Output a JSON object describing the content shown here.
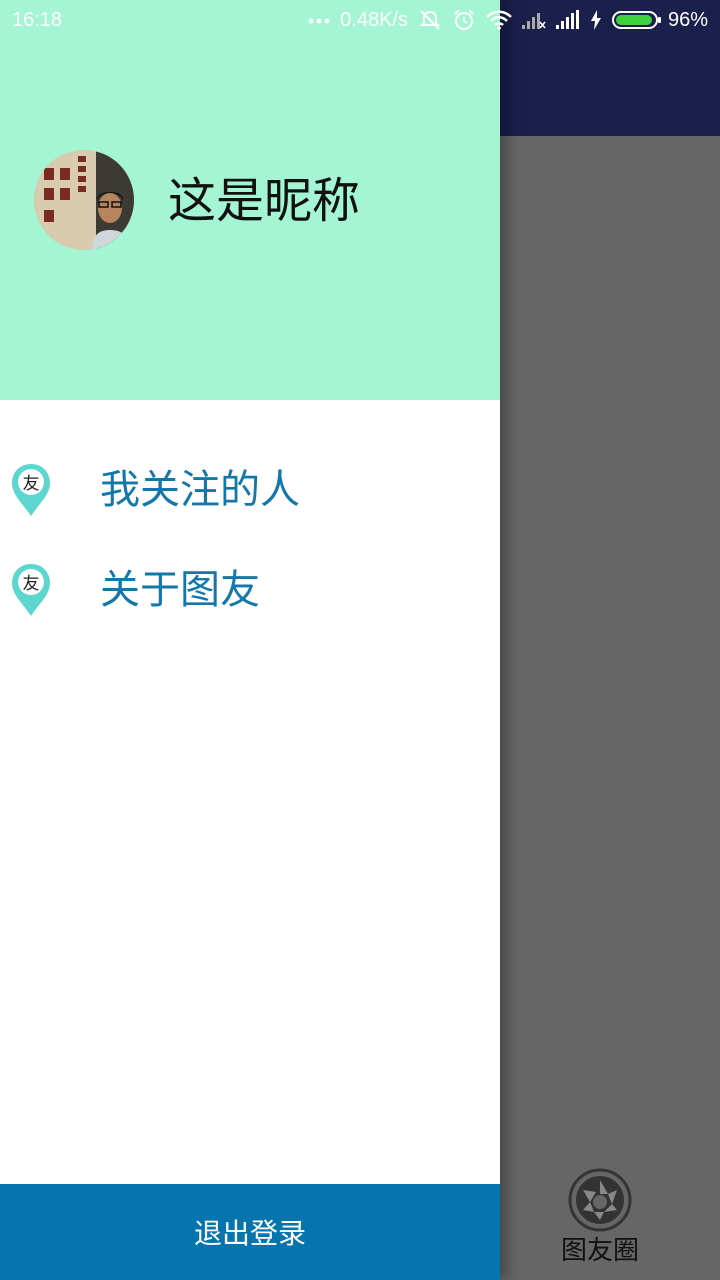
{
  "status_bar": {
    "time": "16:18",
    "net_speed": "0.48K/s",
    "battery": "96%",
    "battery_level": 0.96,
    "icons": [
      "more-dots-icon",
      "alarm-off-icon",
      "alarm-icon",
      "wifi-icon",
      "signal-x-icon",
      "signal-icon",
      "charging-icon",
      "battery-icon"
    ]
  },
  "drawer": {
    "nickname": "这是昵称",
    "menu": [
      {
        "label": "我关注的人",
        "icon": "you-pin-icon"
      },
      {
        "label": "关于图友",
        "icon": "you-pin-icon"
      }
    ],
    "icon_glyph": "友",
    "logout_label": "退出登录"
  },
  "background_app": {
    "bottom_nav_label": "图友圈",
    "bottom_nav_icon": "camera-aperture-icon"
  },
  "colors": {
    "header_bg": "#a3f5d3",
    "accent": "#0675ae",
    "menu_text": "#1377aa",
    "toolbar": "#1b1f4b",
    "pin_teal": "#5ed6d0"
  }
}
